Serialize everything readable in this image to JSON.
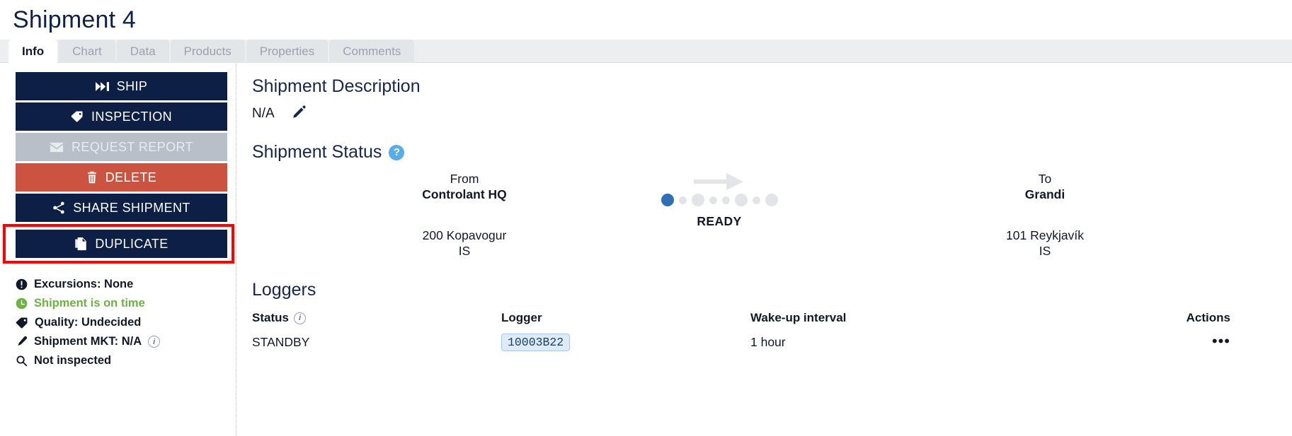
{
  "header": {
    "title": "Shipment 4"
  },
  "tabs": [
    {
      "label": "Info",
      "active": true
    },
    {
      "label": "Chart",
      "active": false
    },
    {
      "label": "Data",
      "active": false
    },
    {
      "label": "Products",
      "active": false
    },
    {
      "label": "Properties",
      "active": false
    },
    {
      "label": "Comments",
      "active": false
    }
  ],
  "sidebar": {
    "buttons": [
      {
        "label": "SHIP",
        "icon": "fast-forward-icon",
        "style": "primary"
      },
      {
        "label": "INSPECTION",
        "icon": "tag-icon",
        "style": "primary"
      },
      {
        "label": "REQUEST REPORT",
        "icon": "envelope-icon",
        "style": "disabled"
      },
      {
        "label": "DELETE",
        "icon": "trash-icon",
        "style": "danger"
      },
      {
        "label": "SHARE SHIPMENT",
        "icon": "share-icon",
        "style": "primary"
      },
      {
        "label": "DUPLICATE",
        "icon": "copy-icon",
        "style": "primary",
        "highlighted": true
      }
    ],
    "status_items": [
      {
        "label": "Excursions: None",
        "icon": "exclamation-circle-icon",
        "color": "#111827"
      },
      {
        "label": "Shipment is on time",
        "icon": "clock-icon",
        "color": "#6cb33f"
      },
      {
        "label": "Quality: Undecided",
        "icon": "tag-icon",
        "color": "#111827"
      },
      {
        "label": "Shipment MKT: N/A",
        "icon": "thermometer-icon",
        "color": "#111827",
        "info": true
      },
      {
        "label": "Not inspected",
        "icon": "magnifier-icon",
        "color": "#111827"
      }
    ]
  },
  "main": {
    "description": {
      "heading": "Shipment Description",
      "value": "N/A",
      "edit_icon": "pencil-icon"
    },
    "status": {
      "heading": "Shipment Status",
      "help_icon": "question-mark-icon",
      "from": {
        "label": "From",
        "name": "Controlant HQ",
        "address": "200 Kopavogur",
        "country": "IS"
      },
      "to": {
        "label": "To",
        "name": "Grandi",
        "address": "101 Reykjavík",
        "country": "IS"
      },
      "state": "READY",
      "dots": [
        {
          "size": "lg",
          "active": true
        },
        {
          "size": "sm",
          "active": false
        },
        {
          "size": "lg",
          "active": false
        },
        {
          "size": "sm",
          "active": false
        },
        {
          "size": "sm",
          "active": false
        },
        {
          "size": "lg",
          "active": false
        },
        {
          "size": "sm",
          "active": false
        },
        {
          "size": "lg",
          "active": false
        }
      ]
    },
    "loggers": {
      "heading": "Loggers",
      "columns": [
        "Status",
        "Logger",
        "Wake-up interval",
        "Actions"
      ],
      "rows": [
        {
          "status": "STANDBY",
          "logger": "10003B22",
          "wakeup": "1 hour",
          "actions": "•••"
        }
      ]
    }
  },
  "colors": {
    "navy": "#0d1f45",
    "danger": "#cb5340",
    "disabled": "#b8bfc9",
    "green": "#6cb33f",
    "accent_blue": "#2f6fb5",
    "help_blue": "#56ade7",
    "highlight": "#ff0000"
  }
}
